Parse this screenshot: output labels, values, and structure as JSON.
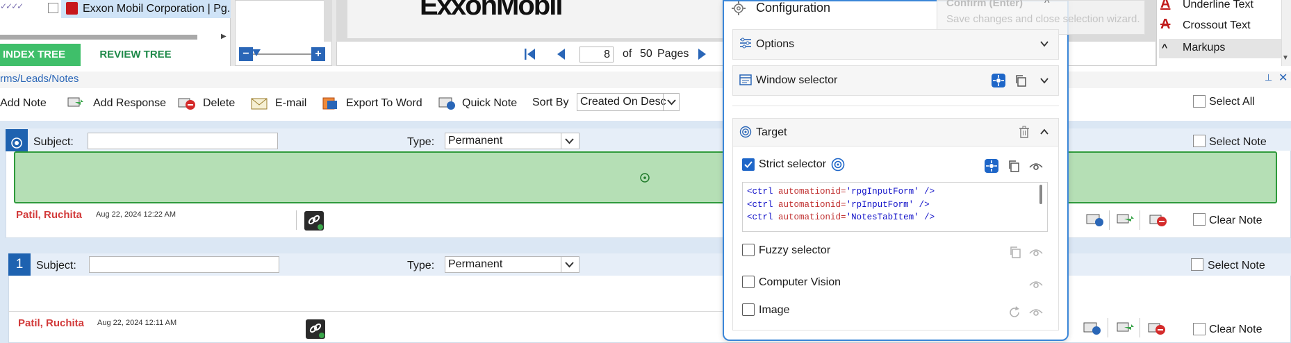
{
  "document_tree": {
    "doc_name": "Exxon Mobil Corporation | Pg.",
    "tabs": [
      "INDEX TREE",
      "REVIEW TREE"
    ]
  },
  "viewer": {
    "logo_text": "ExxonMobil",
    "current_page": "8",
    "of_label": "of",
    "total_pages": "50",
    "pages_label": "Pages"
  },
  "markups": {
    "items": [
      {
        "label": "Underline Text",
        "icon": "underline-icon"
      },
      {
        "label": "Crossout Text",
        "icon": "crossout-icon"
      },
      {
        "label": "Markups",
        "icon": "chevron-up-icon"
      }
    ]
  },
  "breadcrumb": "rms/Leads/Notes",
  "toolbar": {
    "add_note": "Add Note",
    "add_response": "Add Response",
    "delete": "Delete",
    "email": "E-mail",
    "export_word": "Export To Word",
    "quick_note": "Quick Note",
    "sort_by_label": "Sort By",
    "sort_by_value": "Created On Desc",
    "select_all": "Select All"
  },
  "notes": [
    {
      "subject_label": "Subject:",
      "type_label": "Type:",
      "type_value": "Permanent",
      "author": "Patil, Ruchita",
      "date": "Aug 22, 2024 12:22 AM",
      "select_label": "Select Note",
      "clear_label": "Clear Note"
    },
    {
      "number": "1",
      "subject_label": "Subject:",
      "type_label": "Type:",
      "type_value": "Permanent",
      "author": "Patil, Ruchita",
      "date": "Aug 22, 2024 12:11 AM",
      "select_label": "Select Note",
      "clear_label": "Clear Note"
    }
  ],
  "configuration": {
    "title": "Configuration",
    "confirm_title": "Confirm (Enter)",
    "confirm_desc": "Save changes and close selection wizard.",
    "sections": {
      "options": "Options",
      "window_selector": "Window selector",
      "target": "Target"
    },
    "selectors": {
      "strict": "Strict selector",
      "fuzzy": "Fuzzy selector",
      "cv": "Computer Vision",
      "image": "Image"
    },
    "strict_checked": true,
    "code_lines": [
      {
        "tag": "<ctrl",
        "attr": "automationid=",
        "val": "'rpgInputForm'",
        "end": " />"
      },
      {
        "tag": "<ctrl",
        "attr": "automationid=",
        "val": "'rpInputForm'",
        "end": " />"
      },
      {
        "tag": "<ctrl",
        "attr": "automationid=",
        "val": "'NotesTabItem'",
        "end": " />"
      }
    ],
    "accent_color": "#1e66c8"
  }
}
